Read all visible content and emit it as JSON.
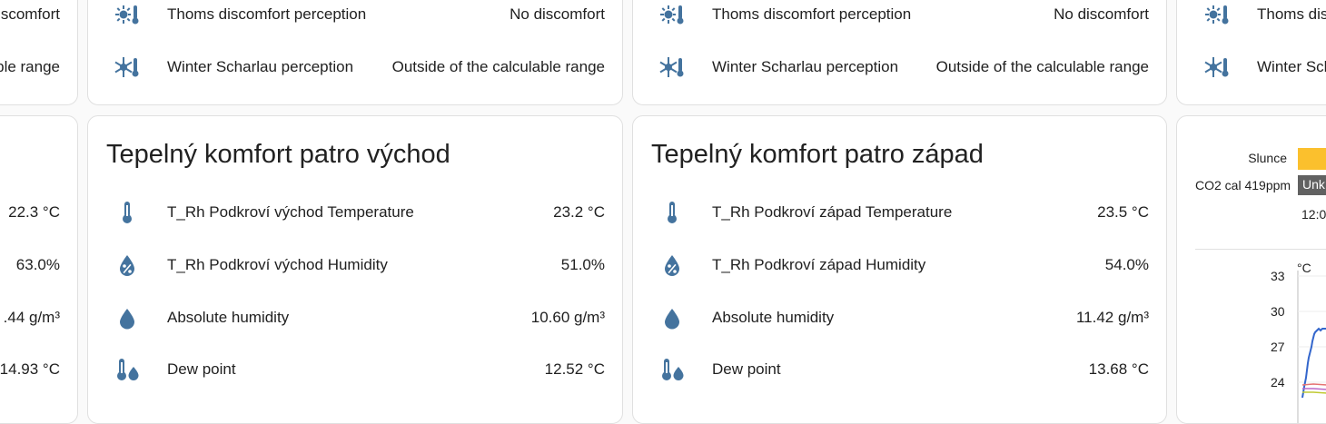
{
  "colors": {
    "icon": "#44739e",
    "sun_bar": "#fbc02d",
    "badge_bg": "#616161",
    "line_blue": "#3366cc"
  },
  "left_partial_top": {
    "rows": [
      {
        "label_tail": "scomfort"
      },
      {
        "label_tail": "ble range"
      }
    ]
  },
  "left_partial_bottom": {
    "values": [
      "22.3 °C",
      "63.0%",
      ".44 g/m³",
      "14.93 °C"
    ]
  },
  "card_east_top": {
    "rows": [
      {
        "icon": "sun-thermometer-icon",
        "label": "Thoms discomfort perception",
        "value": "No discomfort"
      },
      {
        "icon": "snowflake-thermometer-icon",
        "label": "Winter Scharlau perception",
        "value": "Outside of the calculable range"
      }
    ]
  },
  "card_west_top": {
    "rows": [
      {
        "icon": "sun-thermometer-icon",
        "label": "Thoms discomfort perception",
        "value": "No discomfort"
      },
      {
        "icon": "snowflake-thermometer-icon",
        "label": "Winter Scharlau perception",
        "value": "Outside of the calculable range"
      }
    ]
  },
  "right_partial_top": {
    "rows": [
      {
        "icon": "sun-thermometer-icon",
        "label": "Thoms dis"
      },
      {
        "icon": "snowflake-thermometer-icon",
        "label": "Winter Sch"
      }
    ]
  },
  "card_east": {
    "title": "Tepelný komfort patro východ",
    "rows": [
      {
        "icon": "thermometer-icon",
        "label": "T_Rh Podkroví východ Temperature",
        "value": "23.2 °C"
      },
      {
        "icon": "water-percent-icon",
        "label": "T_Rh Podkroví východ Humidity",
        "value": "51.0%"
      },
      {
        "icon": "water-drop-icon",
        "label": "Absolute humidity",
        "value": "10.60 g/m³"
      },
      {
        "icon": "thermometer-water-icon",
        "label": "Dew point",
        "value": "12.52 °C"
      }
    ]
  },
  "card_west": {
    "title": "Tepelný komfort patro západ",
    "rows": [
      {
        "icon": "thermometer-icon",
        "label": "T_Rh Podkroví západ Temperature",
        "value": "23.5 °C"
      },
      {
        "icon": "water-percent-icon",
        "label": "T_Rh Podkroví západ Humidity",
        "value": "54.0%"
      },
      {
        "icon": "water-drop-icon",
        "label": "Absolute humidity",
        "value": "11.42 g/m³"
      },
      {
        "icon": "thermometer-water-icon",
        "label": "Dew point",
        "value": "13.68 °C"
      }
    ]
  },
  "history_card": {
    "timeline": [
      {
        "label": "Slunce"
      },
      {
        "label": "CO2 cal 419ppm",
        "badge": "Unk"
      }
    ],
    "time_tick": "12:0",
    "unit": "°C",
    "y_ticks": [
      "33",
      "30",
      "27",
      "24"
    ]
  }
}
